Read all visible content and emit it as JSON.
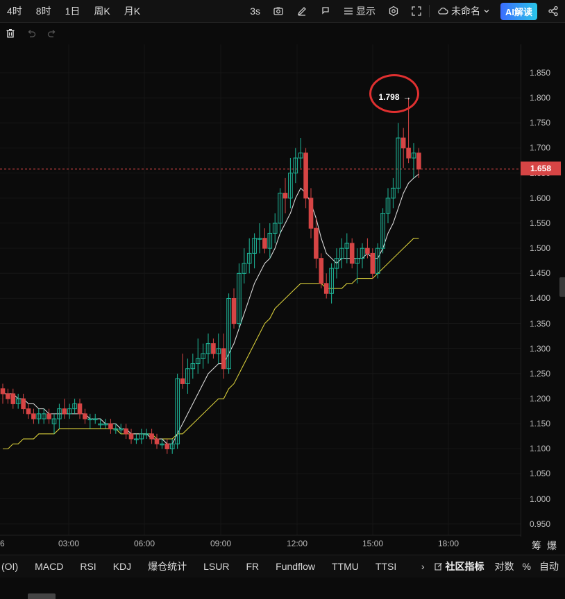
{
  "timeframes": [
    "4时",
    "8时",
    "1日",
    "周K",
    "月K"
  ],
  "toolbar": {
    "interval": "3s",
    "display_label": "显示",
    "workspace_label": "未命名",
    "ai_label": "AI解读"
  },
  "chart": {
    "y_ticks": [
      "1.850",
      "1.800",
      "1.750",
      "1.700",
      "1.650",
      "1.600",
      "1.550",
      "1.500",
      "1.450",
      "1.400",
      "1.350",
      "1.300",
      "1.250",
      "1.200",
      "1.150",
      "1.100",
      "1.050",
      "1.000",
      "0.950"
    ],
    "x_ticks": [
      "6",
      "03:00",
      "06:00",
      "09:00",
      "12:00",
      "15:00",
      "18:00"
    ],
    "current_price": "1.658",
    "peak_label": "1.798",
    "peak_arrow": "→",
    "corner_label": "筹爆",
    "colors": {
      "up": "#1fb89a",
      "down": "#d64545",
      "ma_fast": "#d9d9d9",
      "ma_slow": "#d6cc3a",
      "bg": "#0b0b0b"
    }
  },
  "chart_data": {
    "type": "candlestick",
    "ylim": [
      0.92,
      1.88
    ],
    "candles": [
      [
        1.22,
        1.23,
        1.19,
        1.21
      ],
      [
        1.21,
        1.22,
        1.19,
        1.2
      ],
      [
        1.21,
        1.22,
        1.18,
        1.19
      ],
      [
        1.19,
        1.21,
        1.18,
        1.2
      ],
      [
        1.2,
        1.21,
        1.17,
        1.18
      ],
      [
        1.18,
        1.19,
        1.16,
        1.17
      ],
      [
        1.17,
        1.18,
        1.15,
        1.16
      ],
      [
        1.16,
        1.18,
        1.15,
        1.17
      ],
      [
        1.16,
        1.18,
        1.15,
        1.17
      ],
      [
        1.17,
        1.18,
        1.15,
        1.16
      ],
      [
        1.15,
        1.17,
        1.13,
        1.16
      ],
      [
        1.16,
        1.19,
        1.14,
        1.18
      ],
      [
        1.18,
        1.2,
        1.16,
        1.17
      ],
      [
        1.17,
        1.19,
        1.16,
        1.18
      ],
      [
        1.18,
        1.2,
        1.17,
        1.19
      ],
      [
        1.19,
        1.2,
        1.16,
        1.17
      ],
      [
        1.17,
        1.18,
        1.15,
        1.16
      ],
      [
        1.16,
        1.17,
        1.14,
        1.16
      ],
      [
        1.16,
        1.17,
        1.15,
        1.16
      ],
      [
        1.15,
        1.16,
        1.14,
        1.15
      ],
      [
        1.15,
        1.16,
        1.14,
        1.15
      ],
      [
        1.15,
        1.16,
        1.13,
        1.14
      ],
      [
        1.14,
        1.15,
        1.13,
        1.14
      ],
      [
        1.14,
        1.15,
        1.13,
        1.14
      ],
      [
        1.14,
        1.15,
        1.12,
        1.13
      ],
      [
        1.13,
        1.14,
        1.11,
        1.12
      ],
      [
        1.12,
        1.13,
        1.11,
        1.12
      ],
      [
        1.12,
        1.14,
        1.11,
        1.13
      ],
      [
        1.13,
        1.14,
        1.12,
        1.13
      ],
      [
        1.13,
        1.14,
        1.11,
        1.12
      ],
      [
        1.12,
        1.13,
        1.1,
        1.11
      ],
      [
        1.11,
        1.12,
        1.1,
        1.11
      ],
      [
        1.11,
        1.12,
        1.09,
        1.1
      ],
      [
        1.1,
        1.12,
        1.09,
        1.11
      ],
      [
        1.11,
        1.25,
        1.1,
        1.24
      ],
      [
        1.24,
        1.29,
        1.22,
        1.23
      ],
      [
        1.23,
        1.28,
        1.21,
        1.26
      ],
      [
        1.26,
        1.29,
        1.24,
        1.27
      ],
      [
        1.27,
        1.32,
        1.25,
        1.28
      ],
      [
        1.28,
        1.31,
        1.26,
        1.29
      ],
      [
        1.29,
        1.33,
        1.27,
        1.31
      ],
      [
        1.31,
        1.32,
        1.28,
        1.29
      ],
      [
        1.29,
        1.33,
        1.27,
        1.3
      ],
      [
        1.3,
        1.33,
        1.24,
        1.26
      ],
      [
        1.26,
        1.41,
        1.25,
        1.4
      ],
      [
        1.4,
        1.42,
        1.34,
        1.35
      ],
      [
        1.35,
        1.47,
        1.34,
        1.45
      ],
      [
        1.45,
        1.5,
        1.43,
        1.47
      ],
      [
        1.47,
        1.52,
        1.45,
        1.49
      ],
      [
        1.49,
        1.53,
        1.46,
        1.52
      ],
      [
        1.52,
        1.55,
        1.49,
        1.52
      ],
      [
        1.52,
        1.54,
        1.49,
        1.5
      ],
      [
        1.5,
        1.55,
        1.48,
        1.53
      ],
      [
        1.53,
        1.57,
        1.51,
        1.55
      ],
      [
        1.55,
        1.62,
        1.53,
        1.61
      ],
      [
        1.61,
        1.64,
        1.57,
        1.6
      ],
      [
        1.6,
        1.68,
        1.58,
        1.65
      ],
      [
        1.65,
        1.7,
        1.63,
        1.68
      ],
      [
        1.68,
        1.72,
        1.66,
        1.69
      ],
      [
        1.69,
        1.7,
        1.58,
        1.6
      ],
      [
        1.6,
        1.62,
        1.52,
        1.54
      ],
      [
        1.54,
        1.56,
        1.46,
        1.48
      ],
      [
        1.48,
        1.49,
        1.42,
        1.43
      ],
      [
        1.43,
        1.45,
        1.4,
        1.41
      ],
      [
        1.41,
        1.47,
        1.39,
        1.46
      ],
      [
        1.46,
        1.5,
        1.44,
        1.48
      ],
      [
        1.48,
        1.52,
        1.46,
        1.5
      ],
      [
        1.5,
        1.53,
        1.47,
        1.51
      ],
      [
        1.51,
        1.52,
        1.46,
        1.47
      ],
      [
        1.47,
        1.5,
        1.43,
        1.48
      ],
      [
        1.48,
        1.51,
        1.46,
        1.5
      ],
      [
        1.5,
        1.52,
        1.48,
        1.49
      ],
      [
        1.49,
        1.5,
        1.44,
        1.45
      ],
      [
        1.45,
        1.51,
        1.44,
        1.5
      ],
      [
        1.5,
        1.58,
        1.49,
        1.57
      ],
      [
        1.57,
        1.62,
        1.55,
        1.6
      ],
      [
        1.6,
        1.64,
        1.58,
        1.62
      ],
      [
        1.62,
        1.75,
        1.61,
        1.72
      ],
      [
        1.72,
        1.74,
        1.66,
        1.7
      ],
      [
        1.7,
        1.8,
        1.67,
        1.68
      ],
      [
        1.68,
        1.71,
        1.64,
        1.69
      ],
      [
        1.69,
        1.7,
        1.64,
        1.658
      ]
    ],
    "ma_fast": [
      1.21,
      1.21,
      1.21,
      1.2,
      1.2,
      1.19,
      1.19,
      1.18,
      1.18,
      1.17,
      1.17,
      1.17,
      1.17,
      1.17,
      1.17,
      1.17,
      1.17,
      1.16,
      1.16,
      1.16,
      1.15,
      1.15,
      1.15,
      1.14,
      1.14,
      1.13,
      1.13,
      1.13,
      1.13,
      1.12,
      1.12,
      1.12,
      1.11,
      1.11,
      1.13,
      1.15,
      1.17,
      1.19,
      1.21,
      1.23,
      1.25,
      1.26,
      1.27,
      1.27,
      1.29,
      1.31,
      1.34,
      1.37,
      1.4,
      1.43,
      1.45,
      1.47,
      1.48,
      1.5,
      1.53,
      1.55,
      1.57,
      1.6,
      1.62,
      1.61,
      1.59,
      1.56,
      1.52,
      1.49,
      1.48,
      1.47,
      1.48,
      1.48,
      1.48,
      1.48,
      1.48,
      1.49,
      1.48,
      1.48,
      1.5,
      1.53,
      1.55,
      1.58,
      1.61,
      1.63,
      1.64,
      1.648
    ],
    "ma_slow": [
      1.1,
      1.1,
      1.11,
      1.11,
      1.12,
      1.12,
      1.12,
      1.13,
      1.13,
      1.13,
      1.13,
      1.14,
      1.14,
      1.14,
      1.14,
      1.14,
      1.14,
      1.14,
      1.14,
      1.14,
      1.14,
      1.14,
      1.14,
      1.13,
      1.13,
      1.13,
      1.13,
      1.13,
      1.13,
      1.13,
      1.12,
      1.12,
      1.12,
      1.12,
      1.13,
      1.13,
      1.14,
      1.15,
      1.16,
      1.17,
      1.18,
      1.19,
      1.2,
      1.2,
      1.22,
      1.23,
      1.25,
      1.27,
      1.29,
      1.31,
      1.33,
      1.35,
      1.36,
      1.38,
      1.39,
      1.4,
      1.41,
      1.42,
      1.43,
      1.43,
      1.43,
      1.43,
      1.43,
      1.42,
      1.42,
      1.42,
      1.42,
      1.43,
      1.43,
      1.44,
      1.44,
      1.44,
      1.44,
      1.45,
      1.46,
      1.47,
      1.48,
      1.49,
      1.5,
      1.51,
      1.52,
      1.52
    ]
  },
  "indicators": [
    "(OI)",
    "MACD",
    "RSI",
    "KDJ",
    "爆仓统计",
    "LSUR",
    "FR",
    "Fundflow",
    "TTMU",
    "TTSI"
  ],
  "indicator_bar": {
    "more_arrow": "›",
    "community_label": "社区指标",
    "log_label": "对数",
    "percent_label": "%",
    "auto_label": "自动"
  }
}
